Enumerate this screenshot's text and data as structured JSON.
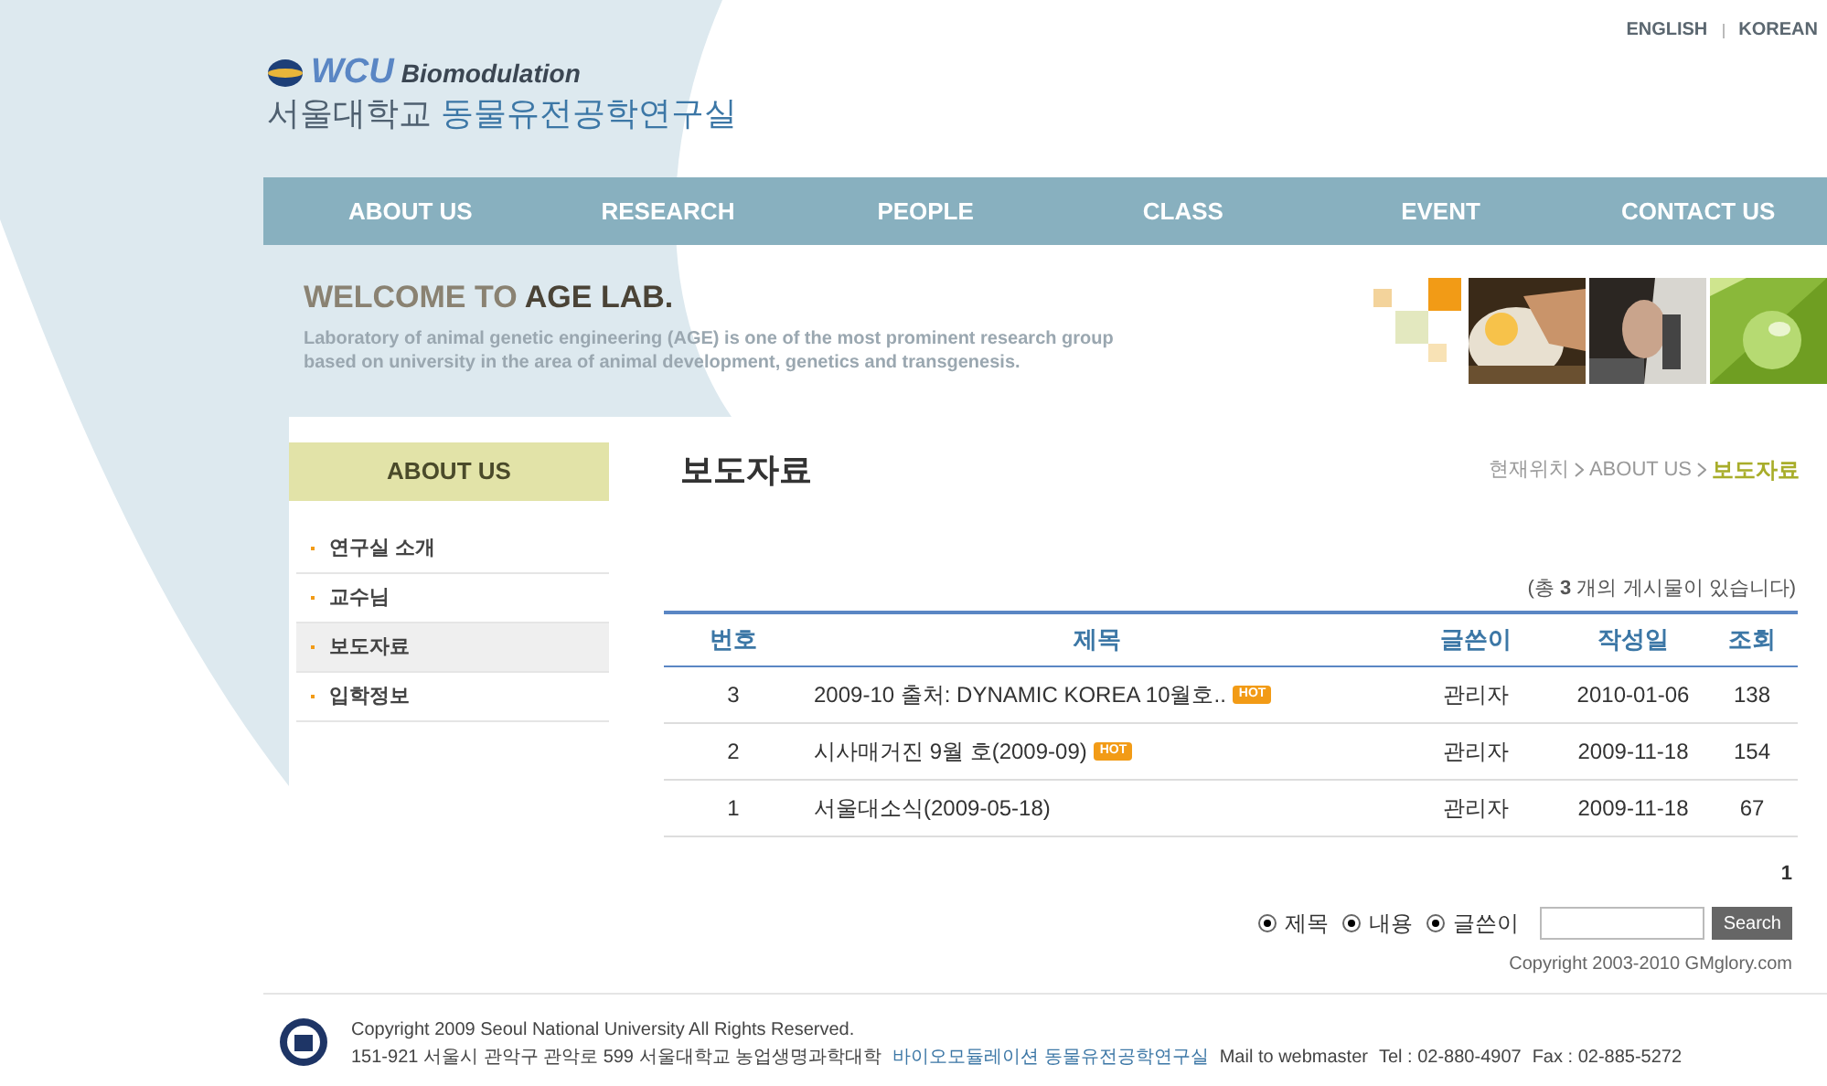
{
  "top_links": [
    "ENGLISH",
    "KOREAN"
  ],
  "logo": {
    "brand": "WCU",
    "subtitle": "Biomodulation",
    "lab_name_a": "서울대학교",
    "lab_name_b": "동물유전공학연구실"
  },
  "nav": [
    "ABOUT US",
    "RESEARCH",
    "PEOPLE",
    "CLASS",
    "EVENT",
    "CONTACT US"
  ],
  "welcome": {
    "title_a": "WELCOME TO",
    "title_b": "AGE LAB.",
    "text": "Laboratory of animal genetic engineering (AGE) is one of the most prominent research group based on university in the area of animal development, genetics and transgenesis."
  },
  "sidebar": {
    "title": "ABOUT US",
    "items": [
      {
        "label": "연구실 소개",
        "selected": false
      },
      {
        "label": "교수님",
        "selected": false
      },
      {
        "label": "보도자료",
        "selected": true
      },
      {
        "label": "입학정보",
        "selected": false
      }
    ]
  },
  "page_title": "보도자료",
  "breadcrumb": [
    "현재위치",
    "ABOUT US",
    "보도자료"
  ],
  "count_text": "(총 **3** 개의 게시물이 있습니다)",
  "table": {
    "columns": [
      "번호",
      "제목",
      "글쓴이",
      "작성일",
      "조회"
    ],
    "rows": [
      {
        "no": "3",
        "title": "2009-10 출처: DYNAMIC KOREA 10월호..",
        "hot": "HOT",
        "author": "관리자",
        "date": "2010-01-06",
        "views": "138"
      },
      {
        "no": "2",
        "title": "시사매거진 9월 호(2009-09)",
        "hot": "HOT",
        "author": "관리자",
        "date": "2009-11-18",
        "views": "154"
      },
      {
        "no": "1",
        "title": "서울대소식(2009-05-18)",
        "author": "관리자",
        "date": "2009-11-18",
        "views": "67"
      }
    ]
  },
  "pagination": [
    {
      "label": "1",
      "selected": true
    }
  ],
  "search": {
    "options": [
      {
        "label": "제목",
        "selected": true
      },
      {
        "label": "내용",
        "selected": true
      },
      {
        "label": "글쓴이",
        "selected": true
      }
    ],
    "button": "Search"
  },
  "board_copyright": "Copyright 2003-2010 GMglory.com",
  "footer": {
    "copyright": "Copyright 2009 Seoul National University All Rights Reserved.",
    "address": "151-921 서울시 관악구 관악로 599 서울대학교 농업생명과학대학",
    "lab_link": "바이오모듈레이션 동물유전공학연구실",
    "mail": "Mail to webmaster",
    "tel": "Tel : 02-880-4907",
    "fax": "Fax : 02-885-5272"
  }
}
